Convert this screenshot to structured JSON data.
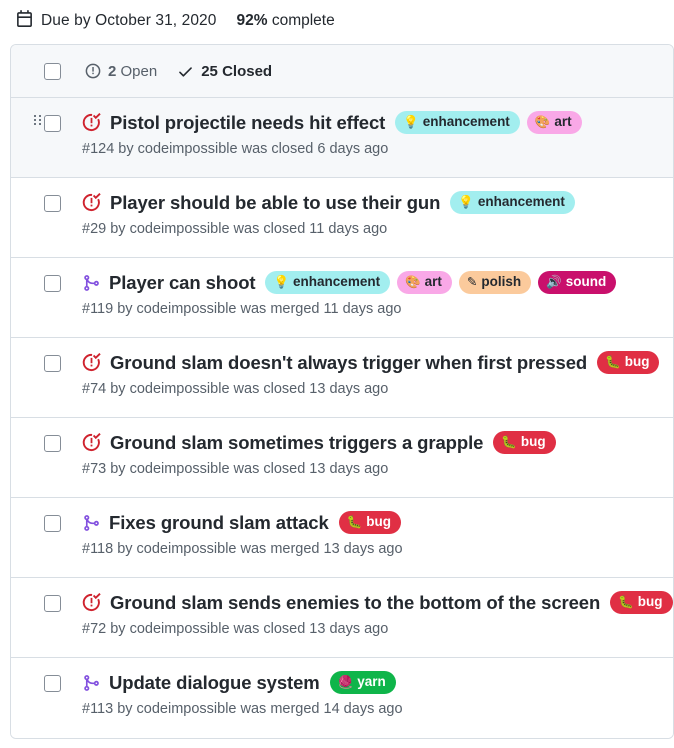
{
  "meta": {
    "calendar_icon": "calendar-icon",
    "due_text": "Due by October 31, 2020",
    "percent": "92%",
    "percent_suffix": " complete"
  },
  "list_header": {
    "open_icon": "issue-opened-icon",
    "open_count": "2",
    "open_label": " Open",
    "closed_icon": "check-icon",
    "closed_count": "25",
    "closed_label": " Closed"
  },
  "colors": {
    "enhancement_bg": "#a2eeef",
    "enhancement_fg": "#24292f",
    "art_bg": "#f9a8e7",
    "art_fg": "#24292f",
    "polish_bg": "#fbca9c",
    "polish_fg": "#24292f",
    "sound_bg": "#c9106c",
    "sound_fg": "#ffffff",
    "bug_bg": "#e02f44",
    "bug_fg": "#ffffff",
    "yarn_bg": "#0fb54a",
    "yarn_fg": "#ffffff",
    "closed_issue_icon": "#cf222e",
    "merged_pr_icon": "#8250df",
    "border": "#d8dee4",
    "header_bg": "#f6f8fa",
    "muted_text": "#57606a"
  },
  "rows": [
    {
      "selected": true,
      "drag_handle": true,
      "icon": "issue-closed-icon",
      "title": "Pistol projectile needs hit effect",
      "labels": [
        {
          "emoji": "💡",
          "text": "enhancement",
          "bg": "#a2eeef",
          "fg": "#24292f"
        },
        {
          "emoji": "🎨",
          "text": "art",
          "bg": "#f9a8e7",
          "fg": "#24292f"
        }
      ],
      "sub": "#124 by codeimpossible was closed 6 days ago"
    },
    {
      "selected": false,
      "drag_handle": false,
      "icon": "issue-closed-icon",
      "title": "Player should be able to use their gun",
      "labels": [
        {
          "emoji": "💡",
          "text": "enhancement",
          "bg": "#a2eeef",
          "fg": "#24292f"
        }
      ],
      "sub": "#29 by codeimpossible was closed 11 days ago"
    },
    {
      "selected": false,
      "drag_handle": false,
      "icon": "pull-request-merged-icon",
      "title": "Player can shoot",
      "labels": [
        {
          "emoji": "💡",
          "text": "enhancement",
          "bg": "#a2eeef",
          "fg": "#24292f"
        },
        {
          "emoji": "🎨",
          "text": "art",
          "bg": "#f9a8e7",
          "fg": "#24292f"
        },
        {
          "emoji": "✎",
          "text": "polish",
          "bg": "#fbca9c",
          "fg": "#24292f"
        },
        {
          "emoji": "🔊",
          "text": "sound",
          "bg": "#c9106c",
          "fg": "#ffffff"
        }
      ],
      "sub": "#119 by codeimpossible was merged 11 days ago"
    },
    {
      "selected": false,
      "drag_handle": false,
      "icon": "issue-closed-icon",
      "title": "Ground slam doesn't always trigger when first pressed",
      "labels": [
        {
          "emoji": "🐛",
          "text": "bug",
          "bg": "#e02f44",
          "fg": "#ffffff"
        }
      ],
      "sub": "#74 by codeimpossible was closed 13 days ago"
    },
    {
      "selected": false,
      "drag_handle": false,
      "icon": "issue-closed-icon",
      "title": "Ground slam sometimes triggers a grapple",
      "labels": [
        {
          "emoji": "🐛",
          "text": "bug",
          "bg": "#e02f44",
          "fg": "#ffffff"
        }
      ],
      "sub": "#73 by codeimpossible was closed 13 days ago"
    },
    {
      "selected": false,
      "drag_handle": false,
      "icon": "pull-request-merged-icon",
      "title": "Fixes ground slam attack",
      "labels": [
        {
          "emoji": "🐛",
          "text": "bug",
          "bg": "#e02f44",
          "fg": "#ffffff"
        }
      ],
      "sub": "#118 by codeimpossible was merged 13 days ago"
    },
    {
      "selected": false,
      "drag_handle": false,
      "icon": "issue-closed-icon",
      "title": "Ground slam sends enemies to the bottom of the screen",
      "labels": [
        {
          "emoji": "🐛",
          "text": "bug",
          "bg": "#e02f44",
          "fg": "#ffffff"
        }
      ],
      "sub": "#72 by codeimpossible was closed 13 days ago"
    },
    {
      "selected": false,
      "drag_handle": false,
      "icon": "pull-request-merged-icon",
      "title": "Update dialogue system",
      "labels": [
        {
          "emoji": "🧶",
          "text": "yarn",
          "bg": "#0fb54a",
          "fg": "#ffffff"
        }
      ],
      "sub": "#113 by codeimpossible was merged 14 days ago"
    }
  ]
}
